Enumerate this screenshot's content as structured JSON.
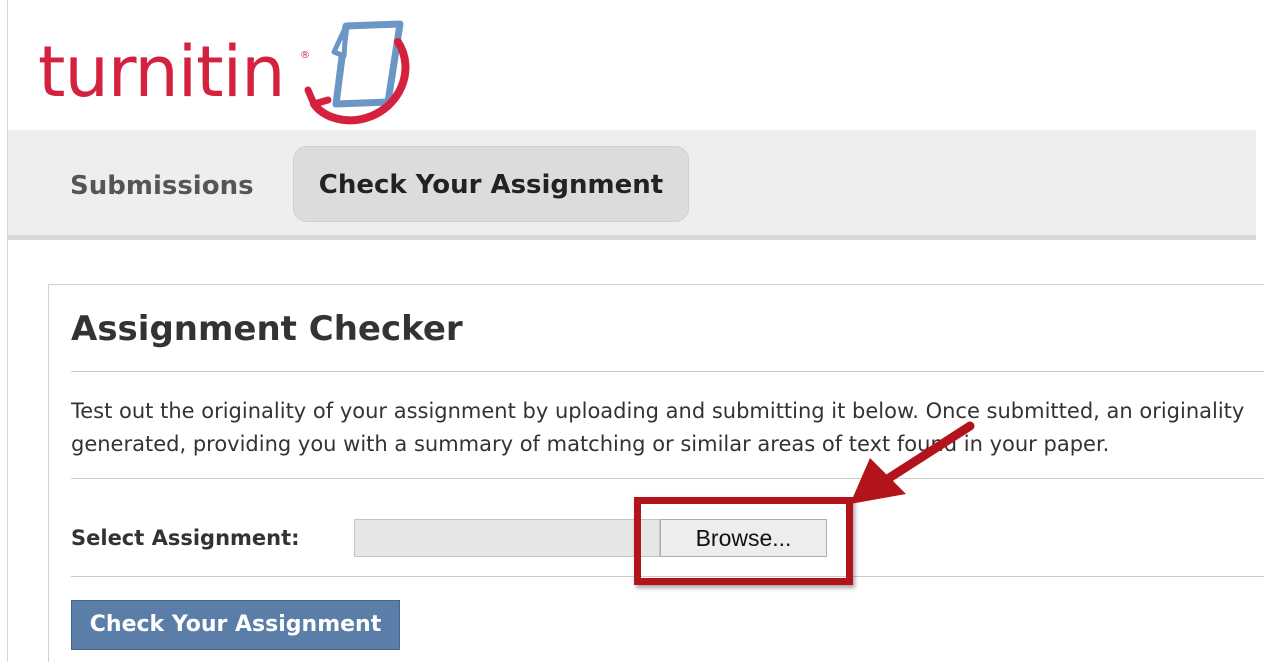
{
  "brand": {
    "logo_text": "turnitin",
    "logo_mark_icon": "turnitin-page-swoosh-icon",
    "colors": {
      "logo_red": "#d4213d",
      "logo_blue": "#6a97c6"
    }
  },
  "tabs": [
    {
      "label": "Submissions",
      "active": false
    },
    {
      "label": "Check Your Assignment",
      "active": true
    }
  ],
  "card": {
    "title": "Assignment Checker",
    "description_line_1": "Test out the originality of your assignment by uploading and submitting it below. Once submitted, an originality",
    "description_line_2": "generated, providing you with a summary of matching or similar areas of text found in your paper.",
    "select_label": "Select Assignment:",
    "file_input": {
      "value": "",
      "browse_label": "Browse..."
    },
    "submit_label": "Check Your Assignment",
    "colors": {
      "submit_bg": "#5b7ea9"
    }
  },
  "annotation": {
    "highlight_color": "#b3131b",
    "arrow_icon": "red-arrow-icon",
    "highlight_target": "browse-button"
  }
}
